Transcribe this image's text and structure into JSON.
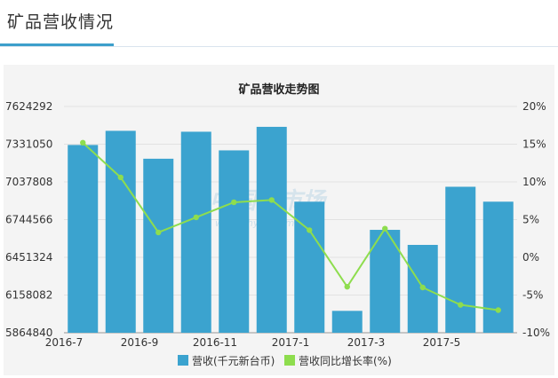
{
  "header": {
    "title": "矿品营收情况"
  },
  "watermark": {
    "text": "中国存市场",
    "subtext": "www.chyxx.com"
  },
  "colors": {
    "bar": "#3ba3cf",
    "line": "#8edd4e",
    "accent": "#3c9fcb"
  },
  "chart_data": {
    "type": "bar",
    "title": "矿品营收走势图",
    "categories": [
      "2016-7",
      "2016-8",
      "2016-9",
      "2016-10",
      "2016-11",
      "2016-12",
      "2017-1",
      "2017-2",
      "2017-3",
      "2017-4",
      "2017-5",
      "2017-6"
    ],
    "x_tick_labels": [
      "2016-7",
      "2016-9",
      "2016-11",
      "2017-1",
      "2017-3",
      "2017-5"
    ],
    "series": [
      {
        "name": "营收(千元新台币)",
        "type": "bar",
        "axis": "left",
        "values": [
          7325000,
          7435000,
          7218000,
          7428000,
          7283000,
          7466000,
          6884000,
          6035000,
          6665000,
          6548000,
          7000000,
          6884000
        ]
      },
      {
        "name": "营收同比增长率(%)",
        "type": "line",
        "axis": "right",
        "values": [
          15.2,
          10.6,
          3.3,
          5.3,
          7.3,
          7.6,
          3.6,
          -3.9,
          3.8,
          -4.0,
          -6.3,
          -7.0
        ]
      }
    ],
    "y_left": {
      "ticks": [
        7624292,
        7331050,
        7037808,
        6744566,
        6451324,
        6158082,
        5864840
      ],
      "ylim": [
        5864840,
        7624292
      ]
    },
    "y_right": {
      "ticks": [
        "20%",
        "15%",
        "10%",
        "5%",
        "0%",
        "-5%",
        "-10%"
      ],
      "ylim": [
        -10,
        20
      ]
    },
    "grid": true,
    "legend_position": "bottom"
  }
}
